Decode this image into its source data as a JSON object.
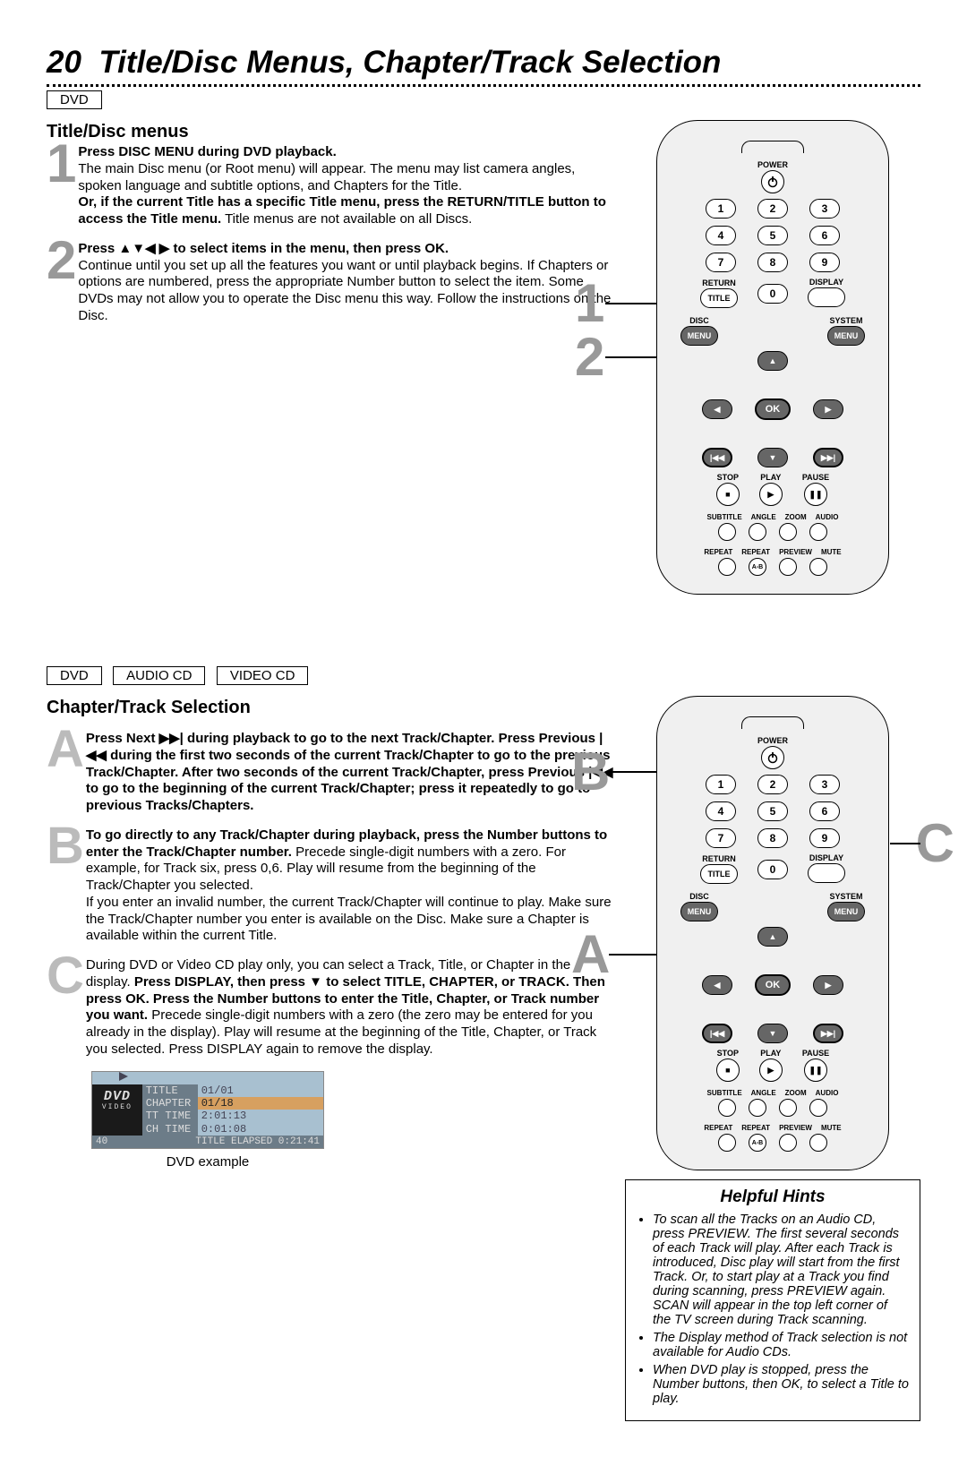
{
  "page": {
    "number": "20",
    "title": "Title/Disc Menus, Chapter/Track Selection"
  },
  "sect1": {
    "tag1": "DVD",
    "heading": "Title/Disc menus",
    "step1": {
      "num": "1",
      "b1": "Press DISC MENU during DVD playback.",
      "t1": "The main Disc menu (or Root menu) will appear. The menu may list camera angles, spoken language and subtitle options, and Chapters for the Title.",
      "b2": "Or, if the current Title has a specific Title menu, press the RETURN/TITLE button to access the Title menu.",
      "t2": " Title menus are not available on all Discs."
    },
    "step2": {
      "num": "2",
      "b1": "Press ▲▼◀ ▶ to select items in the menu, then press OK.",
      "t1": "Continue until you set up all the features you want or until playback begins. If Chapters or options are numbered, press the appropriate Number button to select the item. Some DVDs may not allow you to operate the Disc menu this way. Follow the instructions on the Disc."
    }
  },
  "sect2": {
    "tag1": "DVD",
    "tag2": "AUDIO CD",
    "tag3": "VIDEO CD",
    "heading": "Chapter/Track Selection",
    "stepA": {
      "num": "A",
      "b1": "Press Next ▶▶| during playback to go to the next Track/Chapter. Press Previous |◀◀ during the first two seconds of the current Track/Chapter to go to the previous Track/Chapter.  After two seconds of the current Track/Chapter, press Previous |◀◀  to go to the beginning of the current Track/Chapter; press it repeatedly to go to previous Tracks/Chapters."
    },
    "stepB": {
      "num": "B",
      "b1": "To go directly to any Track/Chapter during playback, press the Number buttons to enter the Track/Chapter number.",
      "t1": "Precede single-digit numbers with a zero. For example, for Track six, press 0,6. Play will resume from the beginning of the Track/Chapter you selected.",
      "t2": "If you enter an invalid number, the current Track/Chapter will continue to play. Make sure the Track/Chapter number you enter is available on the Disc. Make sure a Chapter is available within the current Title."
    },
    "stepC": {
      "num": "C",
      "t1": "During DVD or Video CD play only, you can select a Track, Title, or Chapter in the display. ",
      "b1": "Press DISPLAY, then press ▼ to select TITLE, CHAPTER, or TRACK. Then press OK. Press the Number buttons to enter the Title, Chapter, or Track number you want.",
      "t2": " Precede single-digit numbers with a zero (the zero may be entered for you already in the display). Play will resume at the beginning of the Title, Chapter, or Track you selected. Press DISPLAY again to remove the display."
    },
    "osd": {
      "title": "TITLE",
      "titlev": "01/01",
      "chapter": "CHAPTER",
      "chapterv": "01/18",
      "tt": "TT TIME",
      "ttv": "2:01:13",
      "ch": "CH TIME",
      "chv": "0:01:08",
      "footerL": "40",
      "footerR": "TITLE ELAPSED 0:21:41",
      "caption": "DVD example"
    }
  },
  "remote": {
    "power": "POWER",
    "nums": [
      "1",
      "2",
      "3",
      "4",
      "5",
      "6",
      "7",
      "8",
      "9",
      "0"
    ],
    "return": "RETURN",
    "display": "DISPLAY",
    "title": "TITLE",
    "disc": "DISC",
    "system": "SYSTEM",
    "menu": "MENU",
    "ok": "OK",
    "stop": "STOP",
    "play": "PLAY",
    "pause": "PAUSE",
    "row1": [
      "SUBTITLE",
      "ANGLE",
      "ZOOM",
      "AUDIO"
    ],
    "row2": [
      "REPEAT",
      "REPEAT",
      "PREVIEW",
      "MUTE"
    ],
    "ab": "A-B"
  },
  "callouts_top": {
    "c1": "1",
    "c2": "2"
  },
  "callouts_bot": {
    "A": "A",
    "B": "B",
    "C": "C"
  },
  "hints": {
    "title": "Helpful Hints",
    "items": [
      "To scan all the Tracks on an Audio CD, press PREVIEW.  The first several seconds of each Track will play.  After each Track is introduced, Disc play will start from the first Track. Or, to start play at a Track you find during scanning, press PREVIEW again. SCAN will appear in the top left corner of the TV screen during Track scanning.",
      "The Display method of Track selection is not available for Audio CDs.",
      "When DVD play is stopped, press the Number buttons, then OK, to select a Title to play."
    ]
  }
}
